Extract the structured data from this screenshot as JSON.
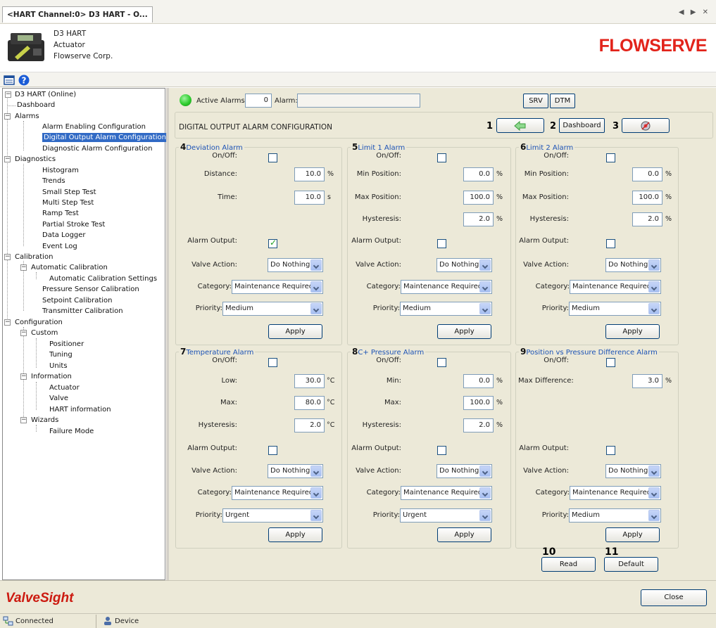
{
  "tab": {
    "title": "<HART Channel:0> D3 HART - O...",
    "nav": "◀ ▶ ✕"
  },
  "device": {
    "name": "D3 HART",
    "type": "Actuator",
    "manufacturer": "Flowserve Corp."
  },
  "brand": "FLOWSERVE",
  "tree": {
    "root": "D3 HART (Online)",
    "dashboard": "Dashboard",
    "alarms": "Alarms",
    "alarm_enabling": "Alarm Enabling Configuration",
    "digital_output": "Digital Output Alarm Configuration",
    "diagnostic_alarm": "Diagnostic Alarm Configuration",
    "diagnostics": "Diagnostics",
    "histogram": "Histogram",
    "trends": "Trends",
    "small_step": "Small Step Test",
    "multi_step": "Multi Step Test",
    "ramp": "Ramp Test",
    "partial_stroke": "Partial Stroke Test",
    "data_logger": "Data Logger",
    "event_log": "Event Log",
    "calibration": "Calibration",
    "auto_cal": "Automatic Calibration",
    "auto_cal_settings": "Automatic Calibration Settings",
    "pressure_sensor": "Pressure Sensor Calibration",
    "setpoint": "Setpoint Calibration",
    "transmitter": "Transmitter Calibration",
    "configuration": "Configuration",
    "custom": "Custom",
    "positioner": "Positioner",
    "tuning": "Tuning",
    "units": "Units",
    "information": "Information",
    "actuator": "Actuator",
    "valve": "Valve",
    "hart_info": "HART information",
    "wizards": "Wizards",
    "failure_mode": "Failure Mode"
  },
  "alarmbar": {
    "active_label": "Active Alarms:",
    "active_count": "0",
    "alarm_label": "Alarm:",
    "alarm_value": "",
    "srv": "SRV",
    "dtm": "DTM",
    "status_color": "#2ecc2e"
  },
  "page": {
    "title": "DIGITAL OUTPUT ALARM CONFIGURATION",
    "n1": "1",
    "n2": "2",
    "n3": "3",
    "dashboard_btn": "Dashboard"
  },
  "labels": {
    "onoff": "On/Off:",
    "distance": "Distance:",
    "time": "Time:",
    "min_position": "Min Position:",
    "max_position": "Max Position:",
    "hysteresis": "Hysteresis:",
    "alarm_output": "Alarm Output:",
    "valve_action": "Valve Action:",
    "category": "Category:",
    "priority": "Priority:",
    "low": "Low:",
    "max": "Max:",
    "min": "Min:",
    "max_difference": "Max Difference:",
    "apply": "Apply"
  },
  "units": {
    "pct": "%",
    "sec": "s",
    "degc": "°C"
  },
  "groups": {
    "deviation": {
      "num": "4",
      "title": "Deviation Alarm",
      "distance": "10.0",
      "time": "10.0",
      "alarm_output": true,
      "valve_action": "Do Nothing",
      "category": "Maintenance Required",
      "priority": "Medium"
    },
    "limit1": {
      "num": "5",
      "title": "Limit 1 Alarm",
      "min_position": "0.0",
      "max_position": "100.0",
      "hysteresis": "2.0",
      "valve_action": "Do Nothing",
      "category": "Maintenance Required",
      "priority": "Medium"
    },
    "limit2": {
      "num": "6",
      "title": "Limit 2 Alarm",
      "min_position": "0.0",
      "max_position": "100.0",
      "hysteresis": "2.0",
      "valve_action": "Do Nothing",
      "category": "Maintenance Required",
      "priority": "Medium"
    },
    "temperature": {
      "num": "7",
      "title": "Temperature Alarm",
      "low": "30.0",
      "max": "80.0",
      "hysteresis": "2.0",
      "valve_action": "Do Nothing",
      "category": "Maintenance Required",
      "priority": "Urgent"
    },
    "cplus": {
      "num": "8",
      "title": "C+ Pressure Alarm",
      "min": "0.0",
      "max": "100.0",
      "hysteresis": "2.0",
      "valve_action": "Do Nothing",
      "category": "Maintenance Required",
      "priority": "Urgent"
    },
    "posvspress": {
      "num": "9",
      "title": "Position vs Pressure Difference Alarm",
      "max_difference": "3.0",
      "valve_action": "Do Nothing",
      "category": "Maintenance Required",
      "priority": "Medium"
    }
  },
  "footer": {
    "n10": "10",
    "n11": "11",
    "read": "Read",
    "default": "Default",
    "valvesight": "ValveSight",
    "close": "Close"
  },
  "status": {
    "connected": "Connected",
    "device": "Device"
  },
  "icons": {
    "back": "back-arrow-icon",
    "settings": "settings-icon",
    "window": "window-icon",
    "help": "help-icon",
    "connected": "network-icon",
    "device": "device-icon"
  }
}
